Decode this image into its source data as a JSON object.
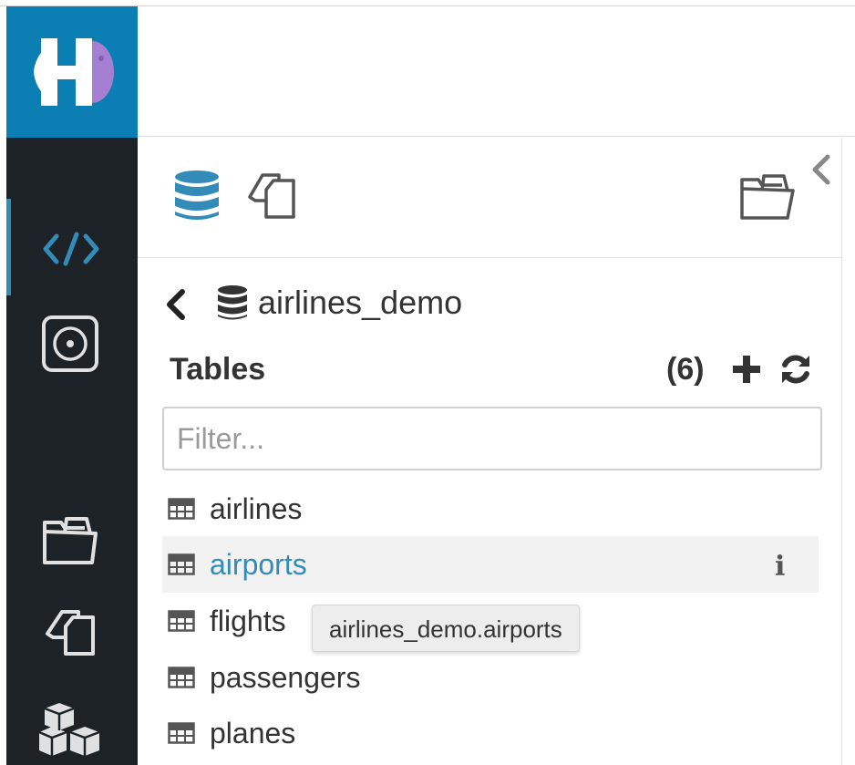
{
  "colors": {
    "rail_bg": "#1d2226",
    "logo_bg": "#0b7eb3",
    "accent": "#338bb8",
    "text": "#333333"
  },
  "rail": {
    "icons": [
      "hue-logo",
      "code-editor-icon",
      "target-icon",
      "file-browser-icon",
      "documents-icon",
      "cubes-icon"
    ]
  },
  "panel": {
    "tabs": [
      "database-icon",
      "documents-icon",
      "file-browser-icon"
    ],
    "collapse_icon": "chevron-left-icon"
  },
  "assist": {
    "database_name": "airlines_demo",
    "section_title": "Tables",
    "count": "(6)",
    "filter_placeholder": "Filter...",
    "tables": [
      {
        "label": "airlines"
      },
      {
        "label": "airports"
      },
      {
        "label": "flights"
      },
      {
        "label": "passengers"
      },
      {
        "label": "planes"
      }
    ],
    "hovered_index": 1,
    "tooltip": "airlines_demo.airports"
  }
}
